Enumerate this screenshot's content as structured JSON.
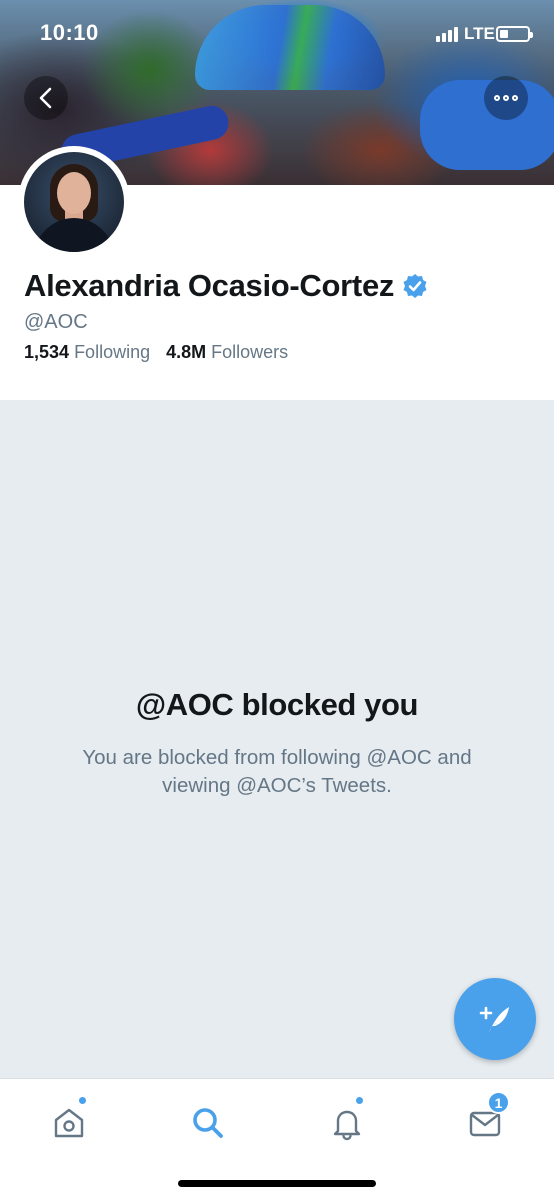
{
  "status_bar": {
    "time": "10:10",
    "network": "LTE"
  },
  "header": {
    "back_icon": "chevron-left-icon",
    "more_icon": "more-dots-icon"
  },
  "profile": {
    "display_name": "Alexandria Ocasio-Cortez",
    "verified": true,
    "handle": "@AOC",
    "following_count": "1,534",
    "following_label": "Following",
    "followers_count": "4.8M",
    "followers_label": "Followers"
  },
  "blocked": {
    "title": "@AOC blocked you",
    "message": "You are blocked from following @AOC and viewing @AOC’s Tweets."
  },
  "compose": {
    "icon": "compose-tweet-icon"
  },
  "tabbar": {
    "items": [
      {
        "name": "home",
        "icon": "home-icon",
        "has_dot": true
      },
      {
        "name": "search",
        "icon": "search-icon",
        "active": true
      },
      {
        "name": "notifications",
        "icon": "bell-icon",
        "has_dot": true
      },
      {
        "name": "messages",
        "icon": "mail-icon",
        "badge": "1"
      }
    ]
  },
  "colors": {
    "accent": "#4aa1eb",
    "secondary_text": "#657786",
    "blocked_bg": "#e6ecf0"
  }
}
